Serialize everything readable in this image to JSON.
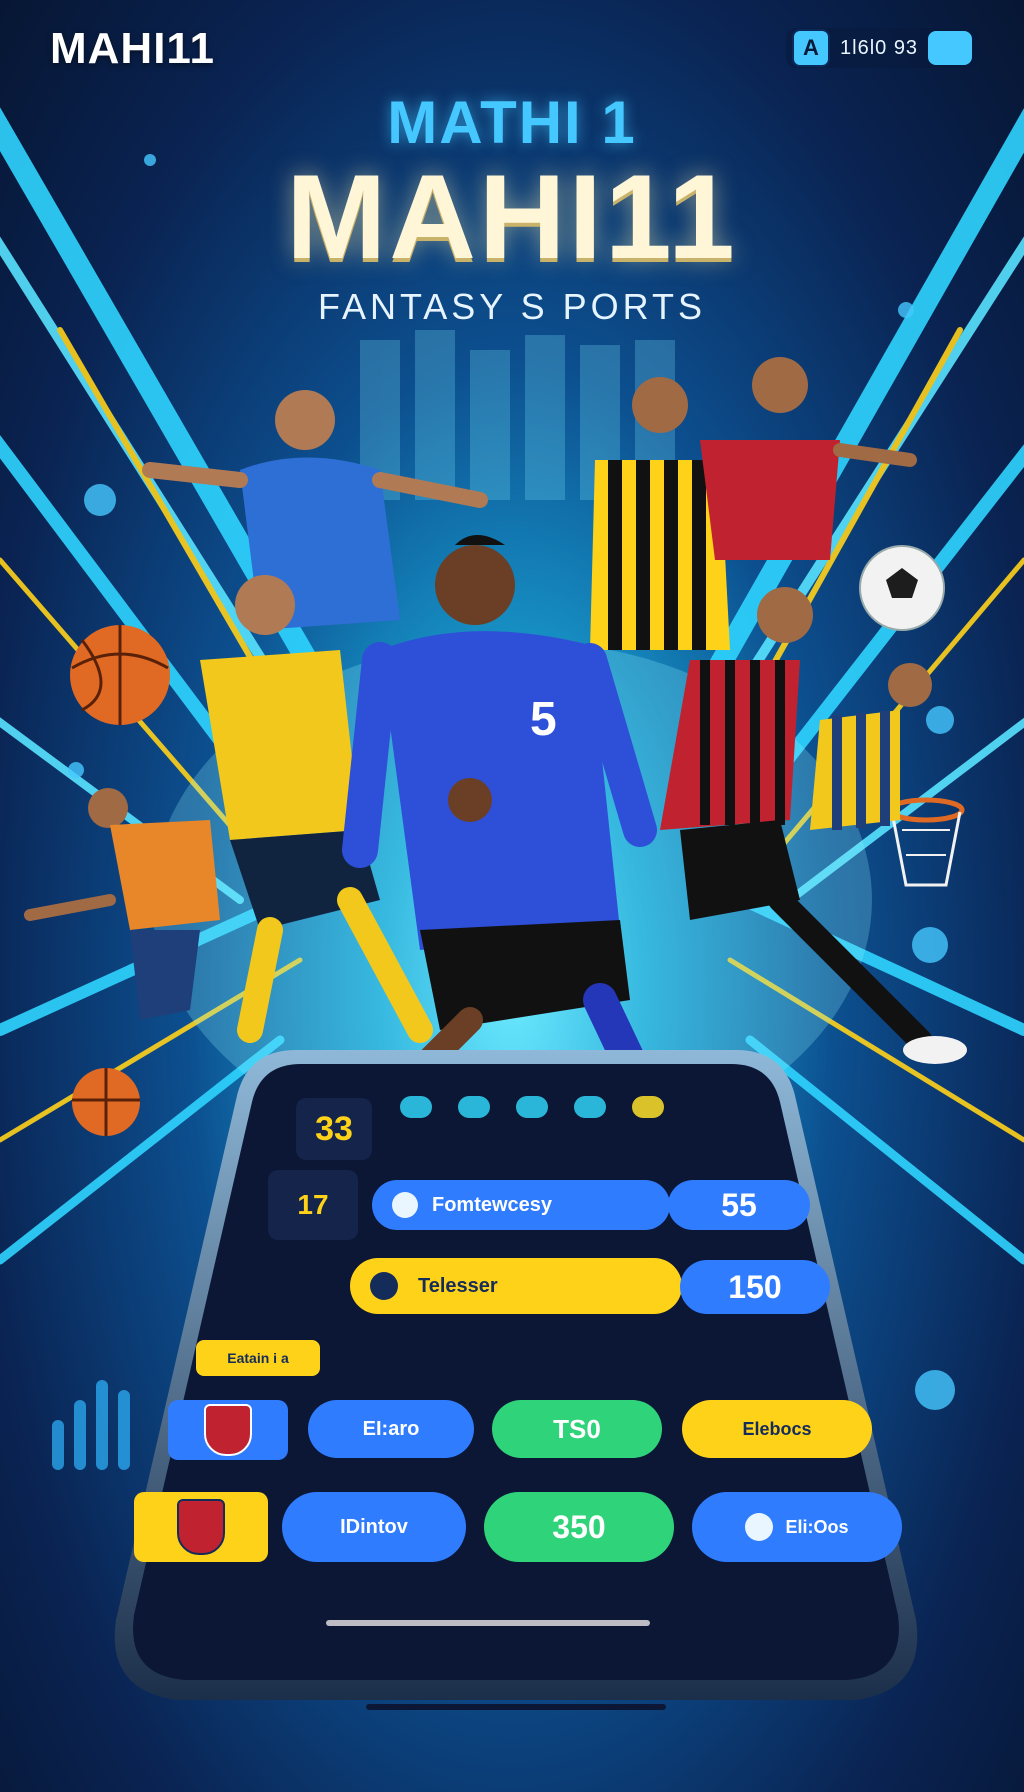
{
  "brand": {
    "logo": "MAHI11"
  },
  "top_badge": {
    "icon": "A",
    "text": "1l6l0 93"
  },
  "headline": {
    "small": "MATHI 1",
    "big": "MAHI11",
    "tagline": "FANTASY S PORTS"
  },
  "icons": [
    "basketball-icon",
    "soccer-ball-icon",
    "basketball-hoop-icon"
  ],
  "player_jersey_numbers": [
    "5"
  ],
  "colors": {
    "accent_cyan": "#45c8ff",
    "accent_yellow": "#ffd21a",
    "accent_green": "#2fd37a",
    "accent_blue": "#2f7cff"
  },
  "phone_app": {
    "score_tile": "33",
    "side_tile": "17",
    "rows": [
      {
        "pill": "Fomtewcesy",
        "value": "55"
      },
      {
        "pill": "Telesser",
        "value": "150"
      }
    ],
    "small_label": "Eatain i a",
    "grid_row_1": [
      "EI:aro",
      "TS0",
      "Elebocs"
    ],
    "grid_row_2": [
      "IDintov",
      "350",
      "Eli:Oos"
    ]
  }
}
